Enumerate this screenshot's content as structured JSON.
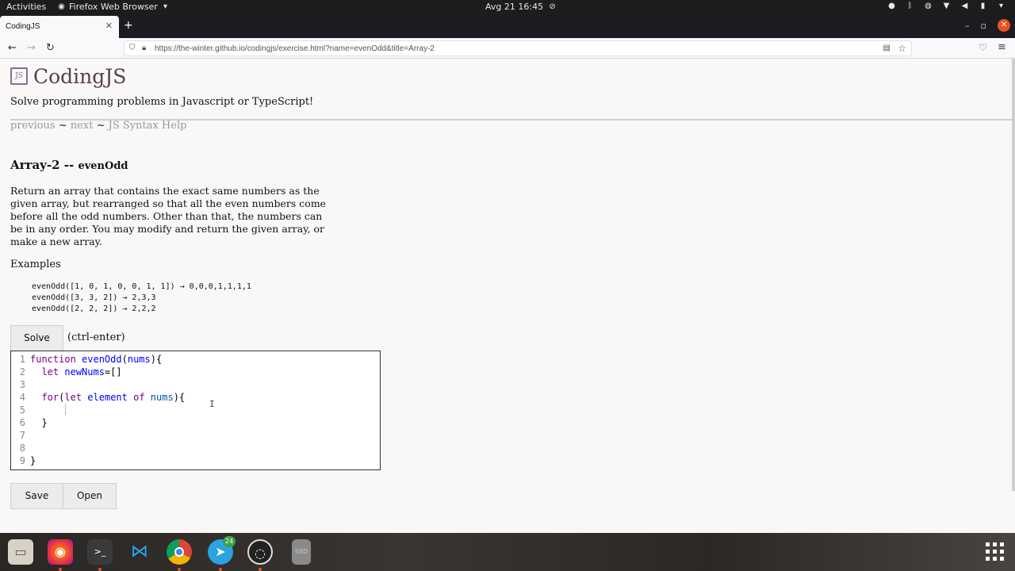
{
  "topbar": {
    "activities": "Activities",
    "app_name": "Firefox Web Browser",
    "clock": "Avg 21  16:45"
  },
  "browser": {
    "tab_title": "CodingJS",
    "url": "https://the-winter.github.io/codingjs/exercise.html?name=evenOdd&title=Array-2"
  },
  "site": {
    "title": "CodingJS",
    "tagline": "Solve programming problems in Javascript or TypeScript!",
    "nav": {
      "previous": "previous",
      "sep1": "~",
      "next": "next",
      "sep2": "~",
      "help": "JS Syntax Help"
    }
  },
  "exercise": {
    "category": "Array-2 --",
    "name": "evenOdd",
    "description": "Return an array that contains the exact same numbers as the given array, but rearranged so that all the even numbers come before all the odd numbers. Other than that, the numbers can be in any order. You may modify and return the given array, or make a new array.",
    "examples_label": "Examples",
    "examples": [
      "evenOdd([1, 0, 1, 0, 0, 1, 1]) → 0,0,0,1,1,1,1",
      "evenOdd([3, 3, 2]) → 2,3,3",
      "evenOdd([2, 2, 2]) → 2,2,2"
    ]
  },
  "controls": {
    "solve": "Solve",
    "solve_hint": "(ctrl-enter)",
    "save": "Save",
    "open": "Open"
  },
  "editor": {
    "line_numbers": [
      "1",
      "2",
      "3",
      "4",
      "5",
      "6",
      "7",
      "8",
      "9"
    ]
  },
  "dock": {
    "telegram_badge": "24"
  }
}
